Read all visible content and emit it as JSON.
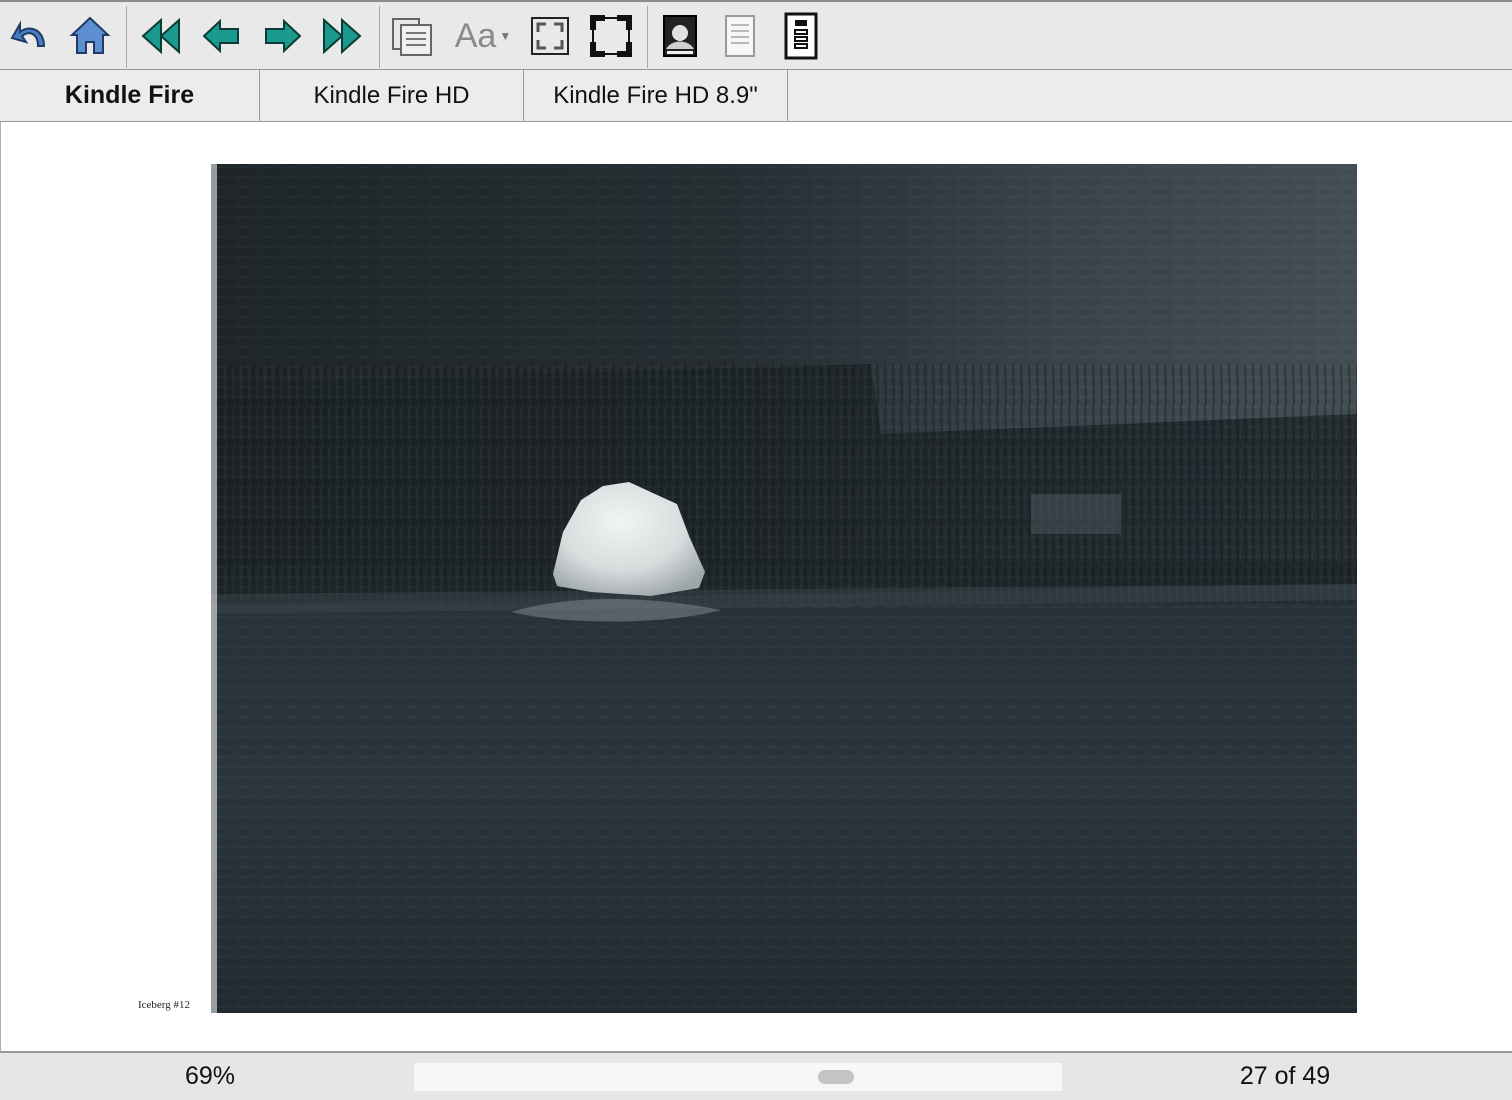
{
  "toolbar": {
    "font_button_label": "Aa",
    "accent_color": "#1a9a8c",
    "home_color": "#4a7ec4",
    "icons": [
      "back-icon",
      "home-icon",
      "first-page-icon",
      "previous-page-icon",
      "next-page-icon",
      "last-page-icon",
      "table-of-contents-icon",
      "font-size-icon",
      "fit-page-icon",
      "actual-size-icon",
      "cover-image-icon",
      "document-icon",
      "device-info-icon"
    ]
  },
  "tabs": [
    {
      "label": "Kindle Fire",
      "active": true
    },
    {
      "label": "Kindle Fire HD",
      "active": false
    },
    {
      "label": "Kindle Fire HD 8.9\"",
      "active": false
    }
  ],
  "content": {
    "caption": "Iceberg #12"
  },
  "status": {
    "zoom": "69%",
    "page": "27 of 49",
    "scroll_position": 0.66
  }
}
